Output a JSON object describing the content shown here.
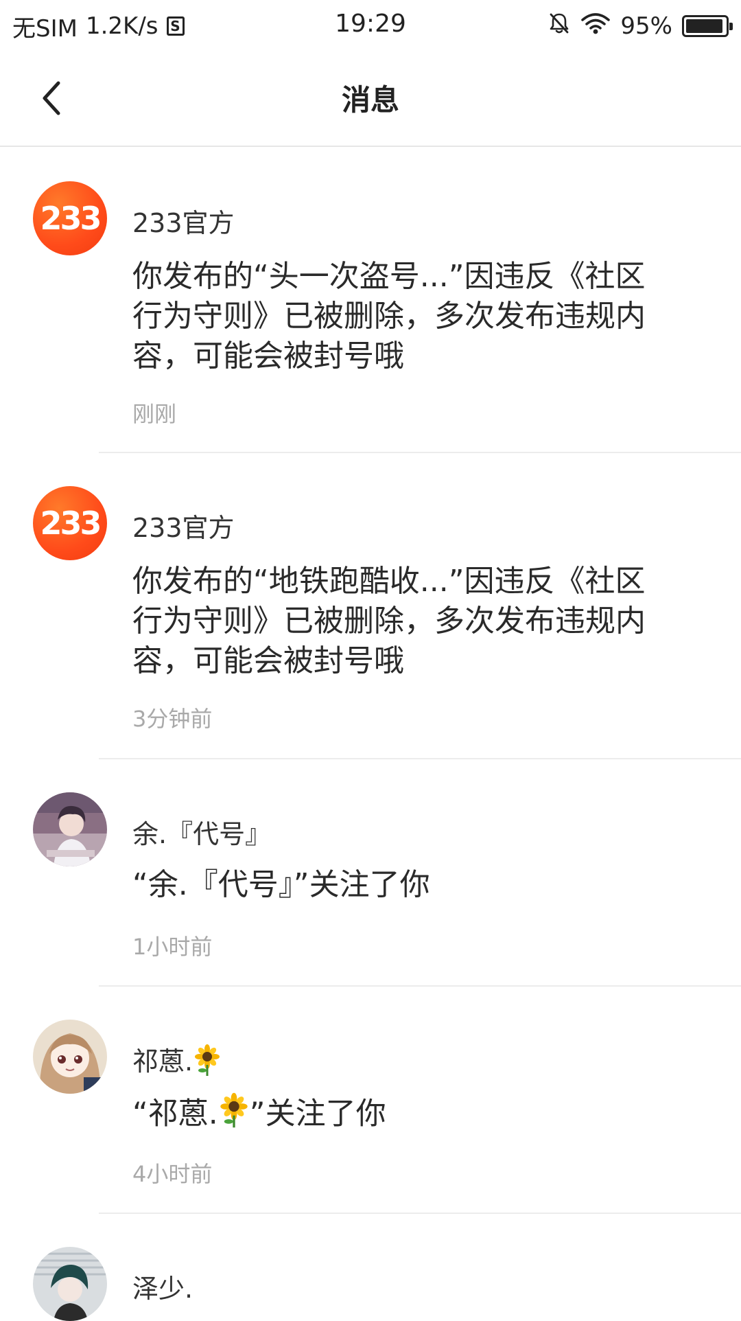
{
  "status_bar": {
    "carrier": "无SIM",
    "speed": "1.2K/s",
    "speed_icon": "S",
    "time": "19:29",
    "battery": "95%",
    "battery_level": 0.95
  },
  "header": {
    "title": "消息"
  },
  "messages": [
    {
      "name": "233官方",
      "body": "你发布的“头一次盗号...”因违反《社区行为守则》已被删除，多次发布违规内容，可能会被封号哦",
      "time": "刚刚",
      "avatar_text": "233"
    },
    {
      "name": "233官方",
      "body": "你发布的“地铁跑酷收...”因违反《社区行为守则》已被删除，多次发布违规内容，可能会被封号哦",
      "time": "3分钟前",
      "avatar_text": "233"
    },
    {
      "name": "余.『代号』",
      "body": "“余.『代号』”关注了你",
      "time": "1小时前"
    },
    {
      "name": "祁蒽.",
      "body_prefix": "“祁蒽.",
      "body_suffix": "”关注了你",
      "time": "4小时前"
    },
    {
      "name": "泽少."
    }
  ],
  "colors": {
    "brand_orange": "#ff4b1a",
    "time_gray": "#a9a9a9",
    "divider": "#ececec"
  }
}
